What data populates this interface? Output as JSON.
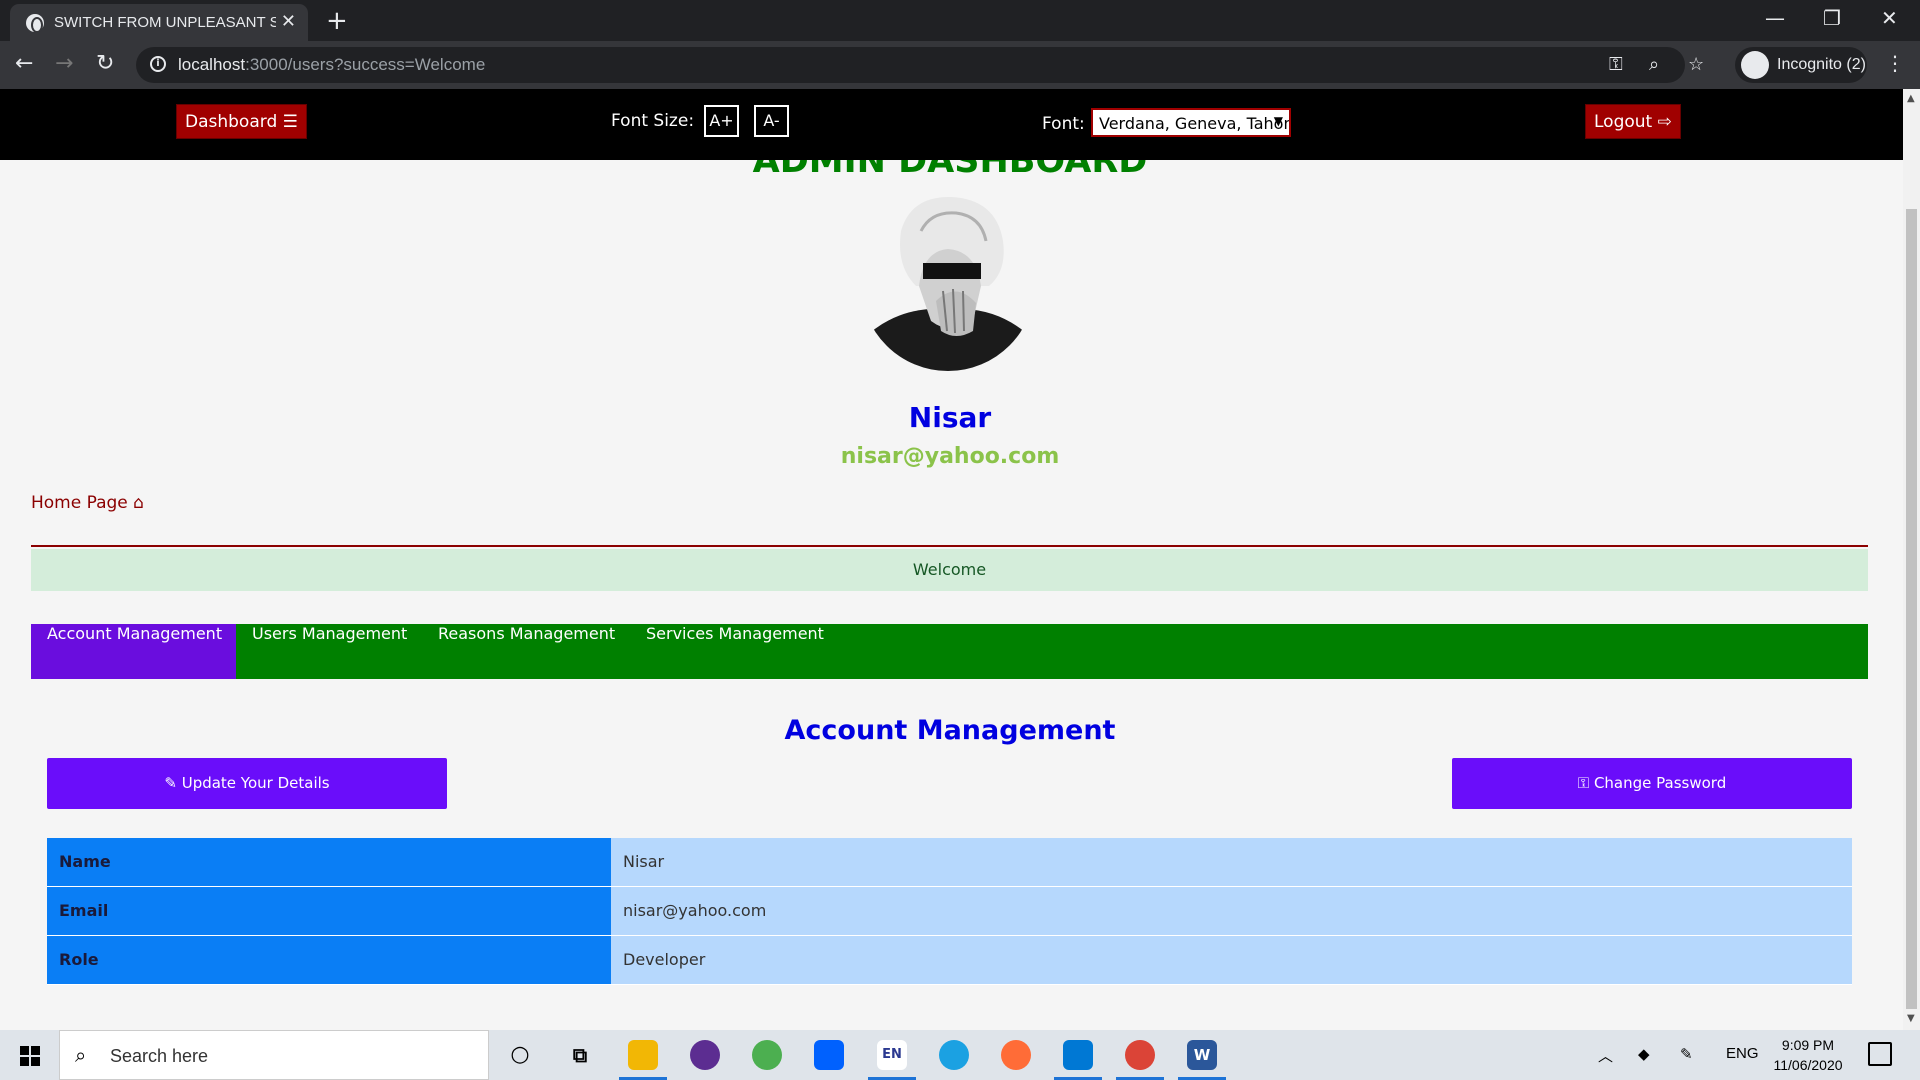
{
  "browser": {
    "tab_title": "SWITCH FROM UNPLEASANT SCENE",
    "tab_close": "✕",
    "new_tab": "+",
    "url_host": "localhost",
    "url_rest": ":3000/users?success=Welcome",
    "incognito_label": "Incognito (2)",
    "window_controls": {
      "minimize": "—",
      "restore": "❐",
      "close": "✕"
    },
    "nav": {
      "back": "←",
      "forward": "→",
      "reload": "↻"
    },
    "omnibox_icons": [
      "key-icon",
      "zoom-icon",
      "star-icon"
    ],
    "kebab": "⋮"
  },
  "topnav": {
    "dashboard_label": "Dashboard ☰",
    "font_size_label": "Font Size:",
    "font_increase": "A+",
    "font_decrease": "A-",
    "font_label": "Font:",
    "font_value": "Verdana, Geneva, Tahoma",
    "logout_label": "Logout ⇨"
  },
  "profile": {
    "heading": "ADMIN DASHBOARD",
    "name": "Nisar",
    "email": "nisar@yahoo.com"
  },
  "home_link": "Home Page ⌂",
  "alert": "Welcome",
  "tabs": [
    "Account Management",
    "Users Management",
    "Reasons Management",
    "Services Management"
  ],
  "active_tab": "Account Management",
  "section_title": "Account Management",
  "buttons": {
    "update": "✎ Update Your Details",
    "change_password": "⚿ Change Password"
  },
  "details": [
    {
      "key": "Name",
      "value": "Nisar"
    },
    {
      "key": "Email",
      "value": "nisar@yahoo.com"
    },
    {
      "key": "Role",
      "value": "Developer"
    }
  ],
  "taskbar": {
    "search_placeholder": "Search here",
    "tray_lang": "ENG",
    "time": "9:09 PM",
    "date": "11/06/2020",
    "apps": [
      "cortana-icon",
      "task-view-icon",
      "file-explorer-icon",
      "github-icon",
      "atom-icon",
      "dropbox-icon",
      "en-icon",
      "edge-icon",
      "postman-icon",
      "vscode-icon",
      "chrome-icon",
      "word-icon"
    ]
  },
  "colors": {
    "nav_bg": "#000000",
    "danger": "#a00000",
    "tabbar": "#008000",
    "active_tab": "#6a0dde",
    "primary_button": "#6a0dfa",
    "table_key": "#0a7ef5",
    "table_value": "#b6d8fd"
  }
}
